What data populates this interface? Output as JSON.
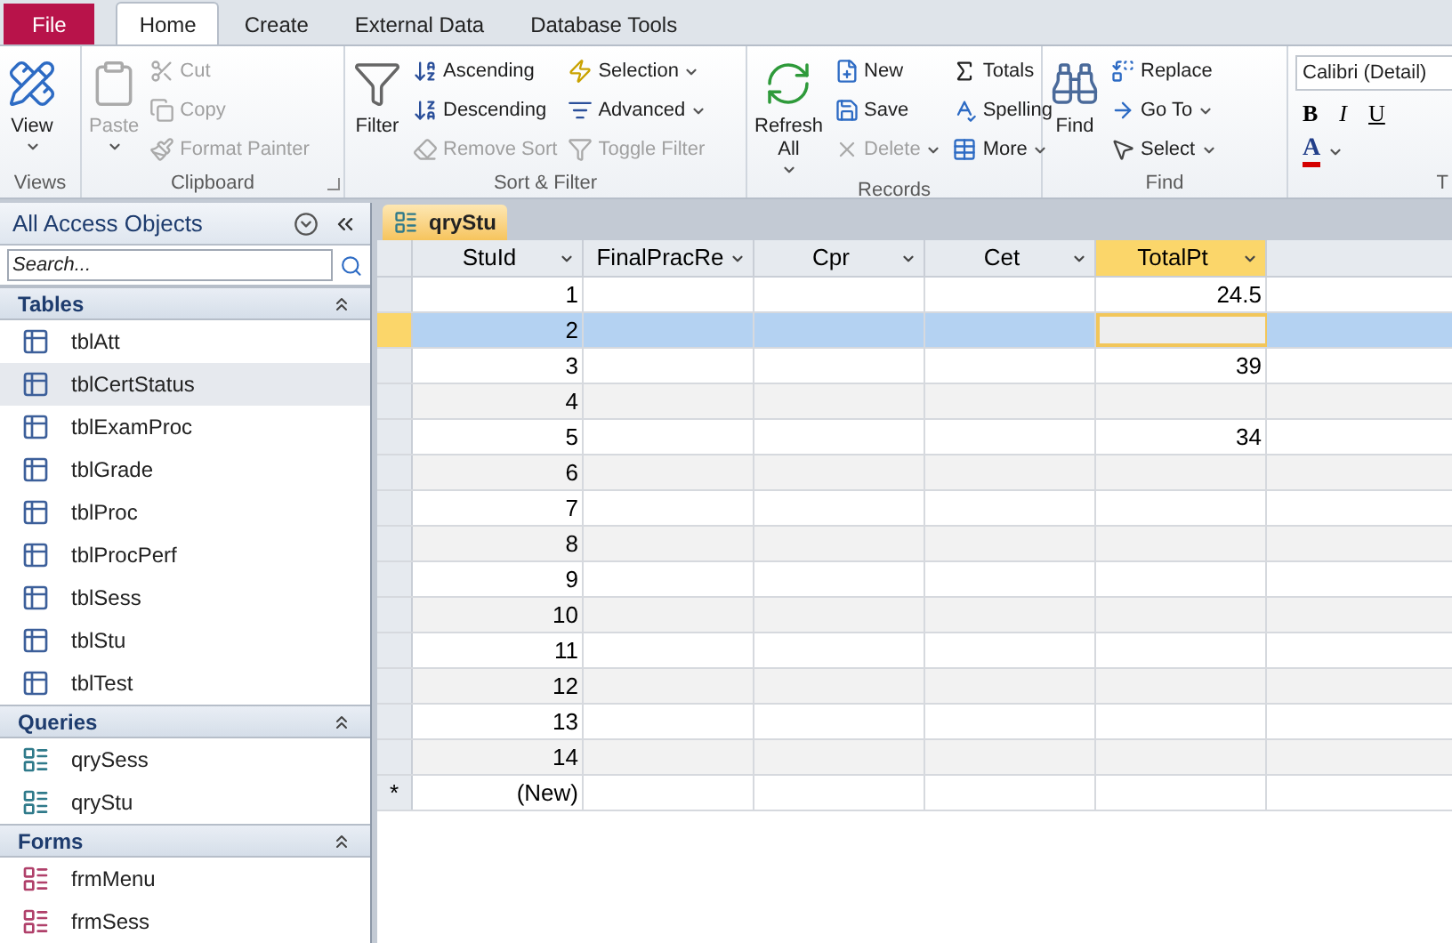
{
  "tabs": [
    {
      "label": "File",
      "kind": "file",
      "selected": false
    },
    {
      "label": "Home",
      "kind": "tab",
      "selected": true
    },
    {
      "label": "Create",
      "kind": "tab",
      "selected": false
    },
    {
      "label": "External Data",
      "kind": "tab",
      "selected": false
    },
    {
      "label": "Database Tools",
      "kind": "tab",
      "selected": false
    }
  ],
  "ribbon": {
    "groups": [
      {
        "label": "Views",
        "launcher": false,
        "columns": [
          [
            {
              "label": "View",
              "kind": "large",
              "dropdown": true,
              "disabled": false
            }
          ]
        ]
      },
      {
        "label": "Clipboard",
        "launcher": true,
        "columns": [
          [
            {
              "label": "Paste",
              "kind": "large",
              "dropdown": true,
              "disabled": true
            }
          ],
          [
            {
              "label": "Cut",
              "kind": "small",
              "dropdown": false,
              "disabled": true
            },
            {
              "label": "Copy",
              "kind": "small",
              "dropdown": false,
              "disabled": true
            },
            {
              "label": "Format Painter",
              "kind": "small",
              "dropdown": false,
              "disabled": true
            }
          ]
        ]
      },
      {
        "label": "Sort & Filter",
        "launcher": false,
        "columns": [
          [
            {
              "label": "Filter",
              "kind": "large",
              "dropdown": false,
              "disabled": false
            }
          ],
          [
            {
              "label": "Ascending",
              "kind": "small",
              "dropdown": false,
              "disabled": false
            },
            {
              "label": "Descending",
              "kind": "small",
              "dropdown": false,
              "disabled": false
            },
            {
              "label": "Remove Sort",
              "kind": "small",
              "dropdown": false,
              "disabled": true
            }
          ],
          [
            {
              "label": "Selection",
              "kind": "small",
              "dropdown": true,
              "disabled": false
            },
            {
              "label": "Advanced",
              "kind": "small",
              "dropdown": true,
              "disabled": false
            },
            {
              "label": "Toggle Filter",
              "kind": "small",
              "dropdown": false,
              "disabled": true
            }
          ]
        ]
      },
      {
        "label": "Records",
        "launcher": false,
        "columns": [
          [
            {
              "label": "Refresh All",
              "kind": "large",
              "dropdown": true,
              "disabled": false
            }
          ],
          [
            {
              "label": "New",
              "kind": "small",
              "dropdown": false,
              "disabled": false
            },
            {
              "label": "Save",
              "kind": "small",
              "dropdown": false,
              "disabled": false
            },
            {
              "label": "Delete",
              "kind": "small",
              "dropdown": true,
              "disabled": true
            }
          ],
          [
            {
              "label": "Totals",
              "kind": "small",
              "dropdown": false,
              "disabled": false
            },
            {
              "label": "Spelling",
              "kind": "small",
              "dropdown": false,
              "disabled": false
            },
            {
              "label": "More",
              "kind": "small",
              "dropdown": true,
              "disabled": false
            }
          ]
        ]
      },
      {
        "label": "Find",
        "launcher": false,
        "columns": [
          [
            {
              "label": "Find",
              "kind": "large",
              "dropdown": false,
              "disabled": false
            }
          ],
          [
            {
              "label": "Replace",
              "kind": "small",
              "dropdown": false,
              "disabled": false
            },
            {
              "label": "Go To",
              "kind": "small",
              "dropdown": true,
              "disabled": false
            },
            {
              "label": "Select",
              "kind": "small",
              "dropdown": true,
              "disabled": false
            }
          ]
        ]
      }
    ],
    "text_group": {
      "label": "T",
      "font": "Calibri (Detail)",
      "bold": "B",
      "italic": "I",
      "underline": "U",
      "font_color": "A"
    }
  },
  "nav": {
    "title": "All Access Objects",
    "search": {
      "placeholder": "Search..."
    },
    "sections": [
      {
        "label": "Tables",
        "kind": "table",
        "items": [
          {
            "label": "tblAtt",
            "selected": false
          },
          {
            "label": "tblCertStatus",
            "selected": true
          },
          {
            "label": "tblExamProc",
            "selected": false
          },
          {
            "label": "tblGrade",
            "selected": false
          },
          {
            "label": "tblProc",
            "selected": false
          },
          {
            "label": "tblProcPerf",
            "selected": false
          },
          {
            "label": "tblSess",
            "selected": false
          },
          {
            "label": "tblStu",
            "selected": false
          },
          {
            "label": "tblTest",
            "selected": false
          }
        ]
      },
      {
        "label": "Queries",
        "kind": "query",
        "items": [
          {
            "label": "qrySess",
            "selected": false
          },
          {
            "label": "qryStu",
            "selected": false
          }
        ]
      },
      {
        "label": "Forms",
        "kind": "form",
        "items": [
          {
            "label": "frmMenu",
            "selected": false
          },
          {
            "label": "frmSess",
            "selected": false
          }
        ]
      }
    ]
  },
  "document_tab": {
    "label": "qryStu"
  },
  "table": {
    "columns": [
      {
        "label": "StuId",
        "selected": false
      },
      {
        "label": "FinalPracRe",
        "selected": false
      },
      {
        "label": "Cpr",
        "selected": false
      },
      {
        "label": "Cet",
        "selected": false
      },
      {
        "label": "TotalPt",
        "selected": true
      }
    ],
    "rows": [
      {
        "stu_id": "1",
        "total_pt": "24.5",
        "selected": false
      },
      {
        "stu_id": "2",
        "selected": true
      },
      {
        "stu_id": "3",
        "total_pt": "39",
        "selected": false
      },
      {
        "stu_id": "4",
        "selected": false
      },
      {
        "stu_id": "5",
        "total_pt": "34",
        "selected": false
      },
      {
        "stu_id": "6",
        "selected": false
      },
      {
        "stu_id": "7",
        "selected": false
      },
      {
        "stu_id": "8",
        "selected": false
      },
      {
        "stu_id": "9",
        "selected": false
      },
      {
        "stu_id": "10",
        "selected": false
      },
      {
        "stu_id": "11",
        "selected": false
      },
      {
        "stu_id": "12",
        "selected": false
      },
      {
        "stu_id": "13",
        "selected": false
      },
      {
        "stu_id": "14",
        "selected": false
      }
    ],
    "new_row": {
      "selector": "*",
      "label": "(New)"
    }
  }
}
